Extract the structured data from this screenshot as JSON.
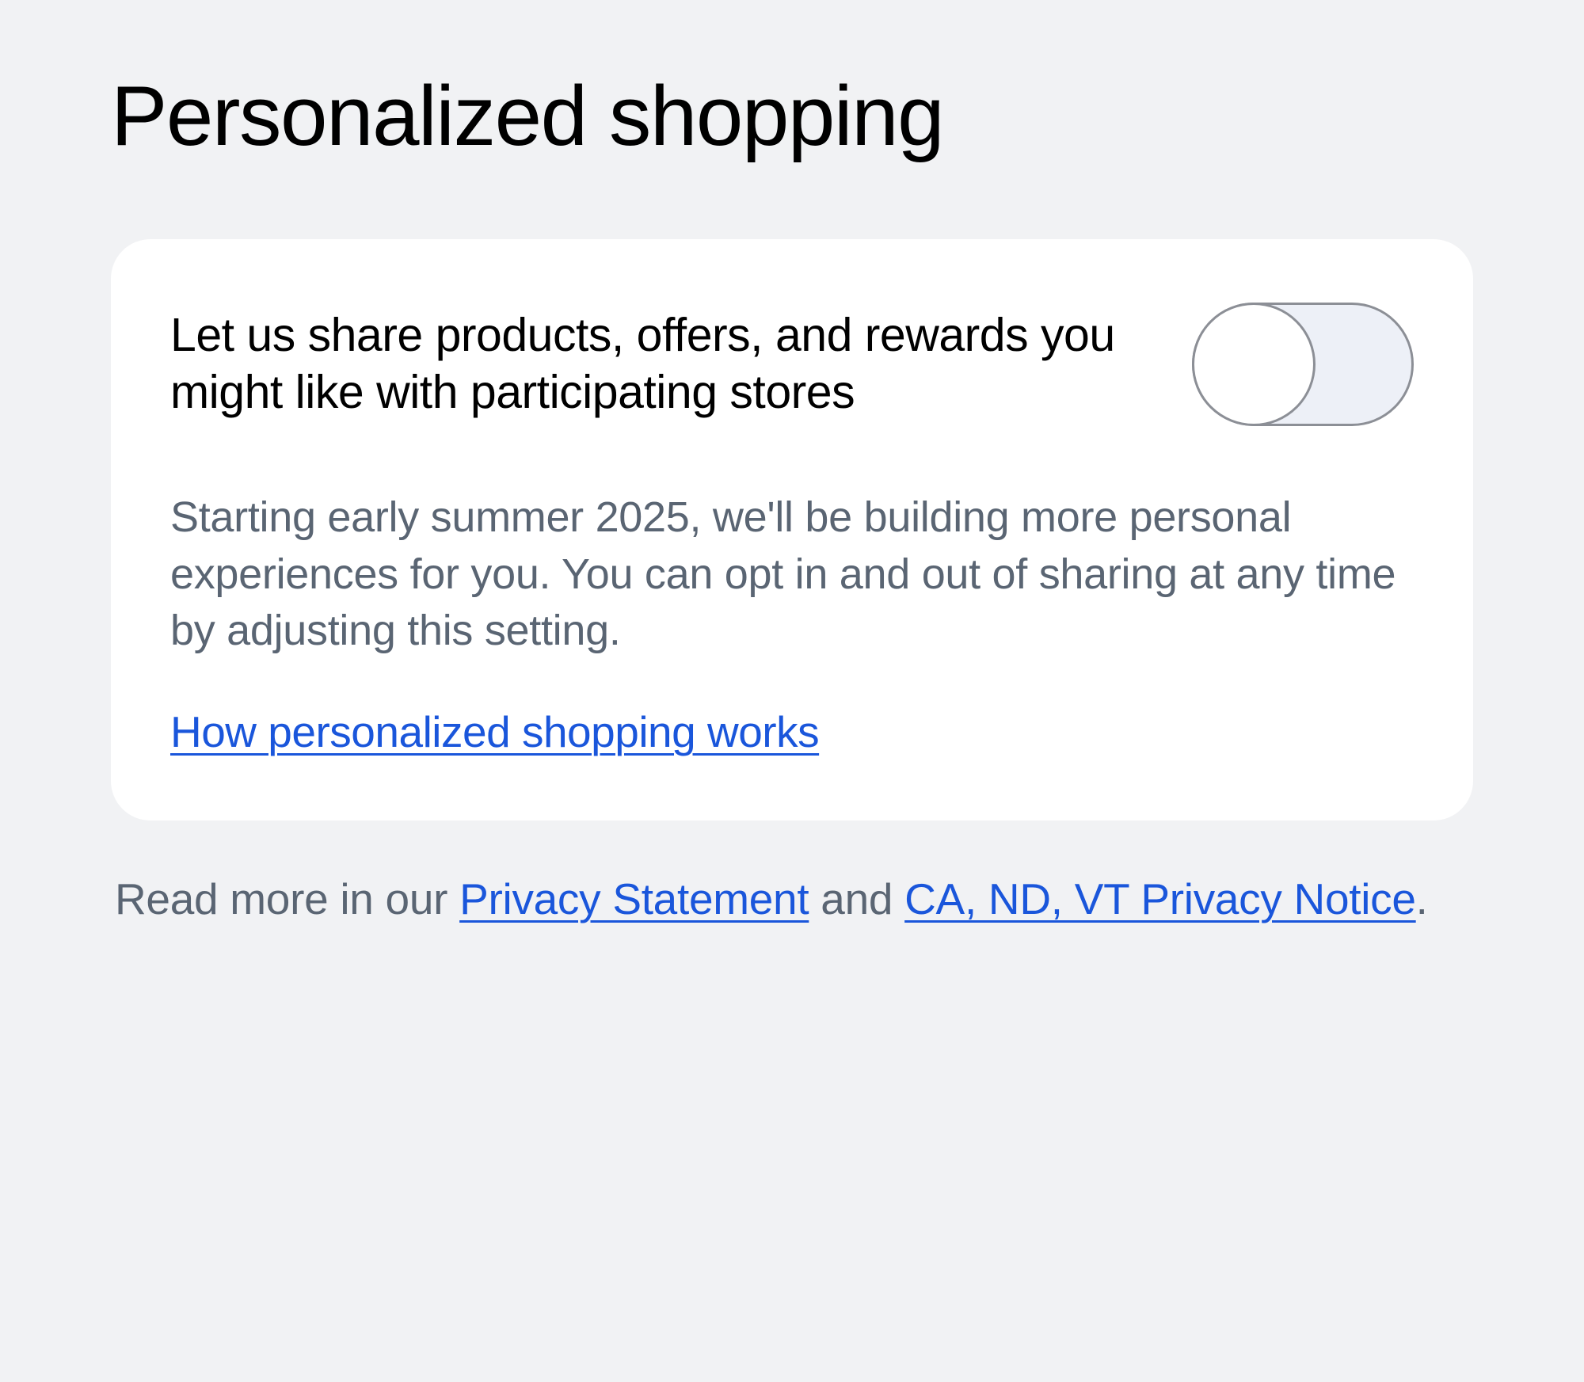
{
  "page": {
    "title": "Personalized shopping"
  },
  "card": {
    "toggle_label": "Let us share products, offers, and rewards you might like with participating stores",
    "toggle_state": "off",
    "description": "Starting early summer 2025, we'll be building more personal experiences for you. You can opt in and out of sharing at any time by adjusting this setting.",
    "how_link": "How personalized shopping works"
  },
  "footer": {
    "prefix": "Read more in our ",
    "privacy_statement_link": "Privacy Statement",
    "connector": " and ",
    "state_notice_link": "CA, ND, VT Privacy Notice",
    "suffix": "."
  }
}
